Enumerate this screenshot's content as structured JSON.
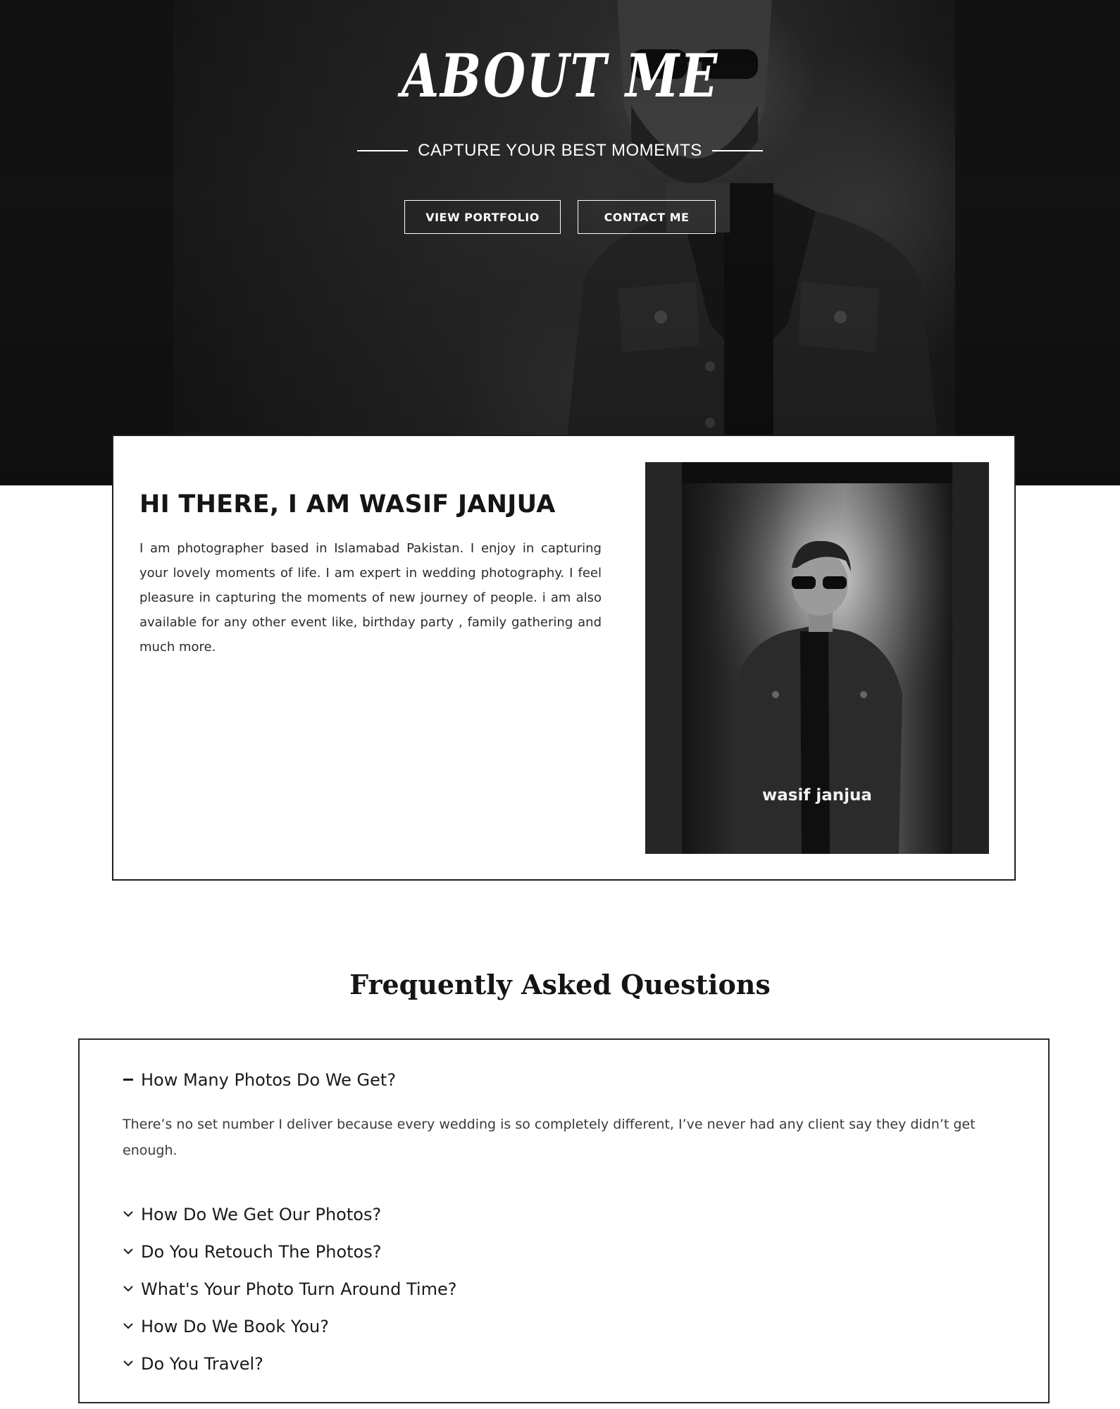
{
  "hero": {
    "title": "ABOUT ME",
    "tagline": "CAPTURE YOUR BEST MOMEMTS",
    "buttons": {
      "portfolio": "VIEW PORTFOLIO",
      "contact": "CONTACT ME"
    }
  },
  "about": {
    "heading": "HI THERE, I AM WASIF JANJUA",
    "body": "I am photographer based in Islamabad Pakistan. I enjoy in capturing your lovely moments of life.  I am expert in wedding photography. I feel pleasure in capturing the moments of new journey of people. i am also available for any other event like, birthday party , family gathering and much more.",
    "photo_caption": "wasif janjua"
  },
  "faq": {
    "title": "Frequently Asked Questions",
    "open_item": {
      "question": "How Many Photos Do We Get?",
      "answer": "There’s no set number I deliver because every wedding is so completely different, I’ve never had any client say they didn’t get enough."
    },
    "items": [
      {
        "question": "How Do We Get Our Photos?"
      },
      {
        "question": "Do You Retouch The Photos?"
      },
      {
        "question": "What's Your Photo Turn Around Time?"
      },
      {
        "question": "How Do We Book You?"
      },
      {
        "question": "Do You Travel?"
      }
    ]
  }
}
